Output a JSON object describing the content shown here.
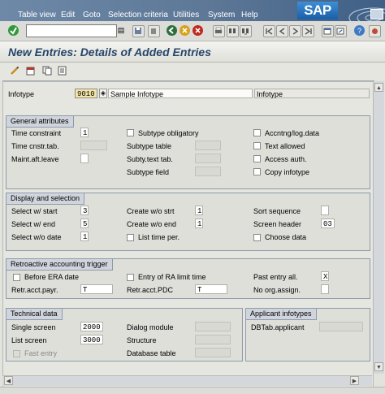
{
  "menubar": {
    "items": [
      "Table view",
      "Edit",
      "Goto",
      "Selection criteria",
      "Utilities",
      "System",
      "Help"
    ],
    "logo_text": "SAP"
  },
  "title": "New Entries: Details of Added Entries",
  "infotype": {
    "label": "Infotype",
    "code": "9010",
    "description": "Sample Infotype",
    "object_label": "Infotype"
  },
  "general": {
    "title": "General attributes",
    "time_constraint_label": "Time constraint",
    "time_constraint_value": "1",
    "time_cnstr_tab_label": "Time cnstr.tab.",
    "maint_aft_leave_label": "Maint.aft.leave",
    "subtype_obligatory_label": "Subtype obligatory",
    "subtype_table_label": "Subtype table",
    "subty_text_tab_label": "Subty.text tab.",
    "subtype_field_label": "Subtype field",
    "accntng_label": "Accntng/log.data",
    "text_allowed_label": "Text allowed",
    "access_auth_label": "Access auth.",
    "copy_infotype_label": "Copy infotype"
  },
  "display": {
    "title": "Display and selection",
    "select_start_label": "Select w/ start",
    "select_start_value": "3",
    "select_end_label": "Select w/ end",
    "select_end_value": "5",
    "select_wo_date_label": "Select w/o date",
    "select_wo_date_value": "1",
    "create_wo_strt_label": "Create w/o strt",
    "create_wo_strt_value": "1",
    "create_wo_end_label": "Create w/o end",
    "create_wo_end_value": "1",
    "list_time_per_label": "List time per.",
    "sort_sequence_label": "Sort sequence",
    "screen_header_label": "Screen header",
    "screen_header_value": "03",
    "choose_data_label": "Choose data"
  },
  "retro": {
    "title": "Retroactive accounting trigger",
    "before_era_label": "Before ERA date",
    "entry_ra_label": "Entry of RA limit time",
    "past_entry_label": "Past entry all.",
    "past_entry_value": "X",
    "retr_payr_label": "Retr.acct.payr.",
    "retr_payr_value": "T",
    "retr_pdc_label": "Retr.acct.PDC",
    "retr_pdc_value": "T",
    "no_org_label": "No org.assign."
  },
  "technical": {
    "title": "Technical data",
    "single_screen_label": "Single screen",
    "single_screen_value": "2000",
    "list_screen_label": "List screen",
    "list_screen_value": "3000",
    "fast_entry_label": "Fast entry",
    "dialog_module_label": "Dialog module",
    "structure_label": "Structure",
    "database_table_label": "Database table"
  },
  "applicant": {
    "title": "Applicant infotypes",
    "dbtab_label": "DBTab.applicant"
  },
  "colors": {
    "title_text": "#26466b",
    "menubar": "#5d7796",
    "group_border": "#8e9aab"
  }
}
